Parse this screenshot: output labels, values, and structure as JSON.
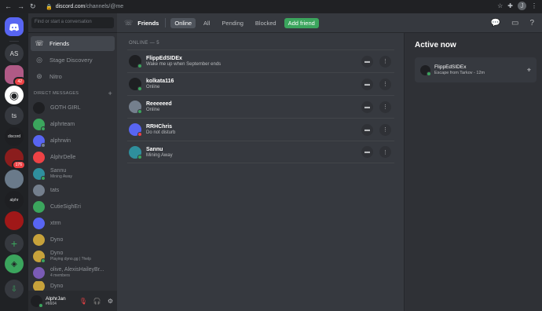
{
  "browser": {
    "back": "←",
    "forward": "→",
    "reload": "↻",
    "url_host": "discord.com",
    "url_path": "/channels/@me",
    "profile_initial": "J"
  },
  "servers": [
    {
      "label": "AS"
    },
    {
      "label": "",
      "badge": "42"
    },
    {
      "label": "◉"
    },
    {
      "label": "ts"
    },
    {
      "label": "discord"
    },
    {
      "label": "",
      "badge": "176"
    },
    {
      "label": ""
    },
    {
      "label": "alphr"
    },
    {
      "label": ""
    },
    {
      "label": "+"
    },
    {
      "label": "◈"
    },
    {
      "label": "⇩"
    }
  ],
  "sidebar": {
    "search_placeholder": "Find or start a conversation",
    "nav": [
      {
        "label": "Friends",
        "icon": "friends-icon"
      },
      {
        "label": "Stage Discovery",
        "icon": "stage-icon"
      },
      {
        "label": "Nitro",
        "icon": "nitro-icon"
      }
    ],
    "dm_header": "DIRECT MESSAGES",
    "dm_add": "+",
    "dms": [
      {
        "name": "GOTH GIRL",
        "sub": ""
      },
      {
        "name": "alphrteam",
        "sub": ""
      },
      {
        "name": "alphrwin",
        "sub": ""
      },
      {
        "name": "AlphrDelle",
        "sub": ""
      },
      {
        "name": "Sannu",
        "sub": "Mining Away"
      },
      {
        "name": "tats",
        "sub": ""
      },
      {
        "name": "CutieSighEri",
        "sub": ""
      },
      {
        "name": "xtrm",
        "sub": ""
      },
      {
        "name": "Dyno",
        "sub": ""
      },
      {
        "name": "Dyno",
        "sub": "Playing dyno.gg | ?help"
      },
      {
        "name": "olive, AlexisHaileyBr...",
        "sub": "4 members"
      },
      {
        "name": "Dyno",
        "sub": ""
      }
    ]
  },
  "user_panel": {
    "name": "AlphrJan",
    "tag": "#6604"
  },
  "topbar": {
    "title": "Friends",
    "tabs": [
      "Online",
      "All",
      "Pending",
      "Blocked"
    ],
    "add_friend": "Add friend"
  },
  "friends": {
    "header": "ONLINE — 5",
    "list": [
      {
        "name": "FlippEdSIDEx",
        "status": "Wake me up when September ends"
      },
      {
        "name": "kolkata116",
        "status": "Online"
      },
      {
        "name": "Reeeeeed",
        "status": "Online"
      },
      {
        "name": "RRHChris",
        "status": "Do not disturb"
      },
      {
        "name": "Sannu",
        "status": "Mining Away"
      }
    ]
  },
  "active_now": {
    "title": "Active now",
    "card": {
      "name": "FlippEdSIDEx",
      "activity": "Escape from Tarkov - 12m"
    }
  },
  "colors": {
    "blurple": "#5865f2",
    "online": "#3ba55d",
    "dnd": "#ed4245",
    "idle": "#faa61a"
  }
}
